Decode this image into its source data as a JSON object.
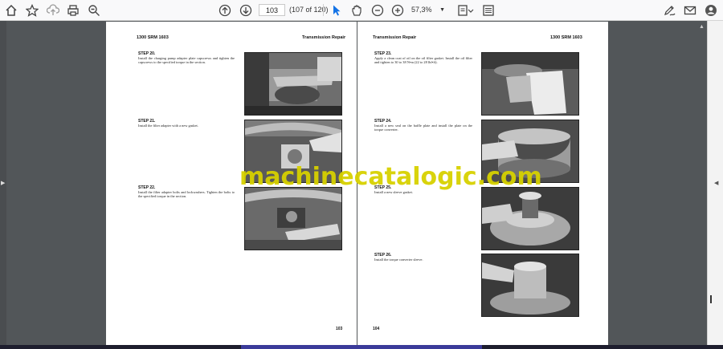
{
  "toolbar": {
    "page_current": "103",
    "page_count": "(107 of 120)",
    "zoom": "57,3%"
  },
  "left_page": {
    "header_left": "1300 SRM 1603",
    "header_right": "Transmission Repair",
    "page_number": "103",
    "steps": [
      {
        "title": "STEP 20.",
        "text": "Install the charging pump adapter plate capscrews and tighten the capscrews to the specified torque in the section."
      },
      {
        "title": "STEP 21.",
        "text": "Install the filter adapter with a new gasket."
      },
      {
        "title": "STEP 22.",
        "text": "Install the filter adapter bolts and lockwashers. Tighten the bolts to the specified torque in the section."
      }
    ]
  },
  "right_page": {
    "header_left": "Transmission Repair",
    "header_right": "1300 SRM 1603",
    "page_number": "104",
    "steps": [
      {
        "title": "STEP 23.",
        "text": "Apply a clean coat of oil on the oil filter gasket. Install the oil filter and tighten to 30 to 38 N•m (22 to 28 lbf•ft)."
      },
      {
        "title": "STEP 24.",
        "text": "Install a new seal on the baffle plate and install the plate on the torque converter."
      },
      {
        "title": "STEP 25.",
        "text": "Install a new sleeve gasket."
      },
      {
        "title": "STEP 26.",
        "text": "Install the torque converter sleeve."
      }
    ]
  },
  "watermark": "machinecatalogic.com",
  "icons": [
    "home-icon",
    "star-icon",
    "upload-icon",
    "print-icon",
    "zoom-out-icon",
    "up-arrow-icon",
    "down-arrow-icon",
    "cursor-icon",
    "hand-icon",
    "zoom-in-icon",
    "fit-page-icon",
    "scroll-mode-icon",
    "sign-icon",
    "email-icon",
    "account-icon"
  ]
}
